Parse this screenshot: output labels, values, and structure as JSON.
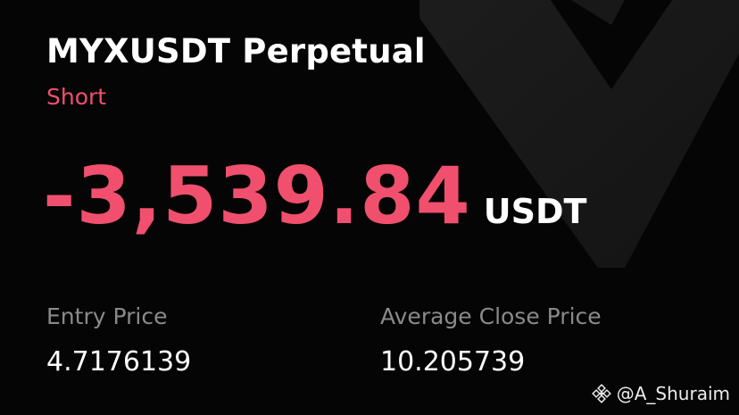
{
  "card": {
    "title": "MYXUSDT Perpetual",
    "side": "Short",
    "pnl_value": "-3,539.84",
    "pnl_unit": "USDT",
    "entry_label": "Entry Price",
    "entry_value": "4.7176139",
    "avg_close_label": "Average Close Price",
    "avg_close_value": "10.205739"
  },
  "watermark": {
    "handle": "@A_Shuraim",
    "icon": "binance-logo-icon"
  },
  "colors": {
    "background": "#050505",
    "loss": "#f0506e",
    "text": "#ffffff",
    "muted": "#8a8a8a"
  }
}
